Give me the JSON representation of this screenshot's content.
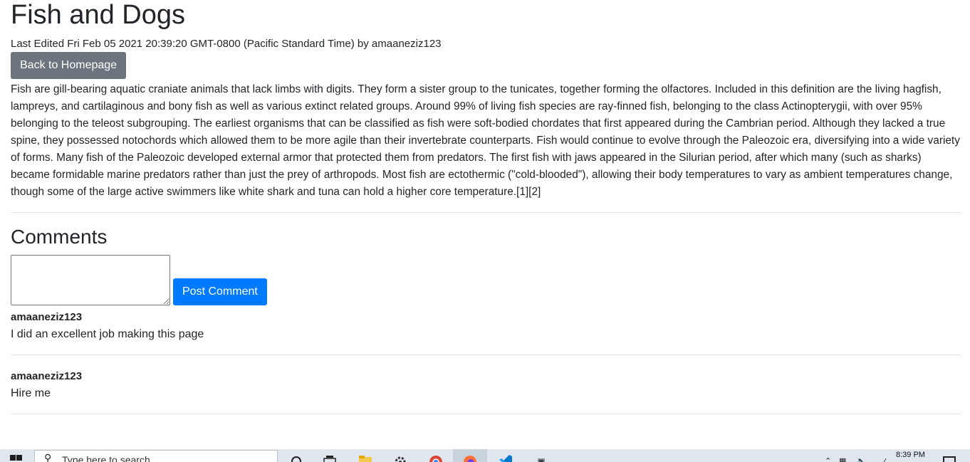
{
  "page": {
    "title": "Fish and Dogs",
    "last_edited": "Last Edited Fri Feb 05 2021 20:39:20 GMT-0800 (Pacific Standard Time) by amaaneziz123",
    "back_button": "Back to Homepage",
    "content": "Fish are gill-bearing aquatic craniate animals that lack limbs with digits. They form a sister group to the tunicates, together forming the olfactores. Included in this definition are the living hagfish, lampreys, and cartilaginous and bony fish as well as various extinct related groups. Around 99% of living fish species are ray-finned fish, belonging to the class Actinopterygii, with over 95% belonging to the teleost subgrouping. The earliest organisms that can be classified as fish were soft-bodied chordates that first appeared during the Cambrian period. Although they lacked a true spine, they possessed notochords which allowed them to be more agile than their invertebrate counterparts. Fish would continue to evolve through the Paleozoic era, diversifying into a wide variety of forms. Many fish of the Paleozoic developed external armor that protected them from predators. The first fish with jaws appeared in the Silurian period, after which many (such as sharks) became formidable marine predators rather than just the prey of arthropods. Most fish are ectothermic (\"cold-blooded\"), allowing their body temperatures to vary as ambient temperatures change, though some of the large active swimmers like white shark and tuna can hold a higher core temperature.[1][2]"
  },
  "comments": {
    "heading": "Comments",
    "input_value": "",
    "post_button": "Post Comment",
    "items": [
      {
        "author": "amaaneziz123",
        "text": "I did an excellent job making this page"
      },
      {
        "author": "amaaneziz123",
        "text": "Hire me"
      }
    ]
  },
  "taskbar": {
    "search_placeholder": "Type here to search",
    "clock": "8:39 PM",
    "icons": [
      "windows-start-icon",
      "search-icon",
      "task-view-icon",
      "file-explorer-icon",
      "settings-icon",
      "chrome-icon",
      "firefox-icon",
      "vscode-icon",
      "app-icon"
    ]
  },
  "colors": {
    "secondary_button": "#6c757d",
    "primary_button": "#007bff",
    "taskbar": "#dfe6ee"
  }
}
